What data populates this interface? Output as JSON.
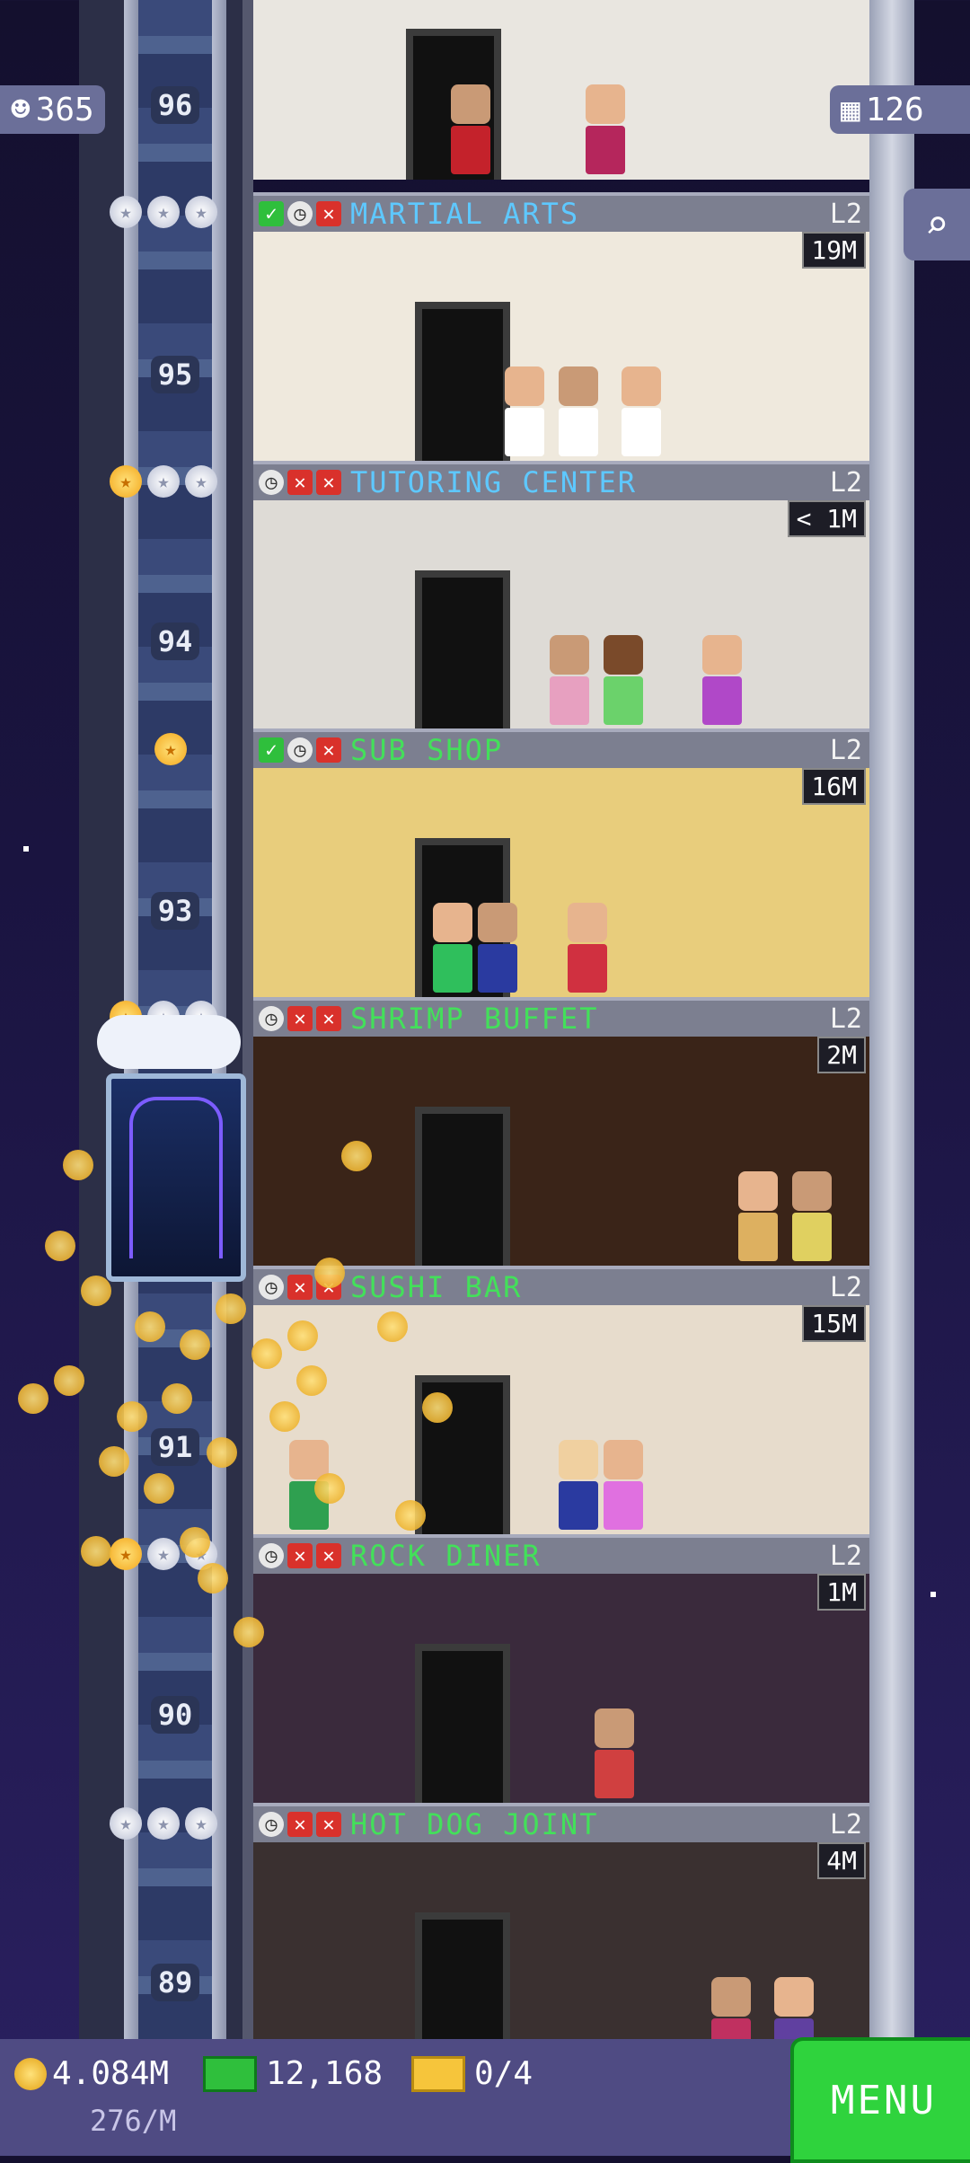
{
  "hud": {
    "population": "365",
    "population_icon": "person-icon",
    "floors": "126",
    "floors_icon": "building-icon"
  },
  "elevator": {
    "floor_labels": [
      "96",
      "95",
      "94",
      "93",
      "91",
      "90",
      "89"
    ]
  },
  "floors": [
    {
      "name": "MARTIAL ARTS",
      "level": "L2",
      "earnings": "19M",
      "status": [
        "ok",
        "clock",
        "x"
      ],
      "stars": [
        "silver",
        "silver",
        "silver"
      ]
    },
    {
      "name": "TUTORING CENTER",
      "level": "L2",
      "earnings": "< 1M",
      "status": [
        "clock",
        "x",
        "x"
      ],
      "stars": [
        "gold",
        "silver",
        "silver"
      ]
    },
    {
      "name": "SUB SHOP",
      "level": "L2",
      "earnings": "16M",
      "status": [
        "ok",
        "clock",
        "x"
      ],
      "stars": [
        "gold"
      ]
    },
    {
      "name": "SHRIMP BUFFET",
      "level": "L2",
      "earnings": "2M",
      "status": [
        "clock",
        "x",
        "x"
      ],
      "stars": [
        "gold",
        "silver",
        "silver"
      ]
    },
    {
      "name": "SUSHI BAR",
      "level": "L2",
      "earnings": "15M",
      "status": [
        "clock",
        "x",
        "x"
      ],
      "stars": []
    },
    {
      "name": "ROCK DINER",
      "level": "L2",
      "earnings": "1M",
      "status": [
        "clock",
        "x",
        "x"
      ],
      "stars": [
        "gold",
        "silver",
        "silver"
      ]
    },
    {
      "name": "HOT DOG JOINT",
      "level": "L2",
      "earnings": "4M",
      "status": [
        "clock",
        "x",
        "x"
      ],
      "stars": [
        "silver",
        "silver",
        "silver"
      ]
    }
  ],
  "bottom": {
    "coins": "4.084M",
    "coins_rate": "276/M",
    "bux": "12,168",
    "tickets": "0/4",
    "menu_label": "MENU"
  },
  "colors": {
    "room_name": "#5ec8ff",
    "room_name_alt": "#43e05a",
    "menu": "#2fd33d"
  }
}
